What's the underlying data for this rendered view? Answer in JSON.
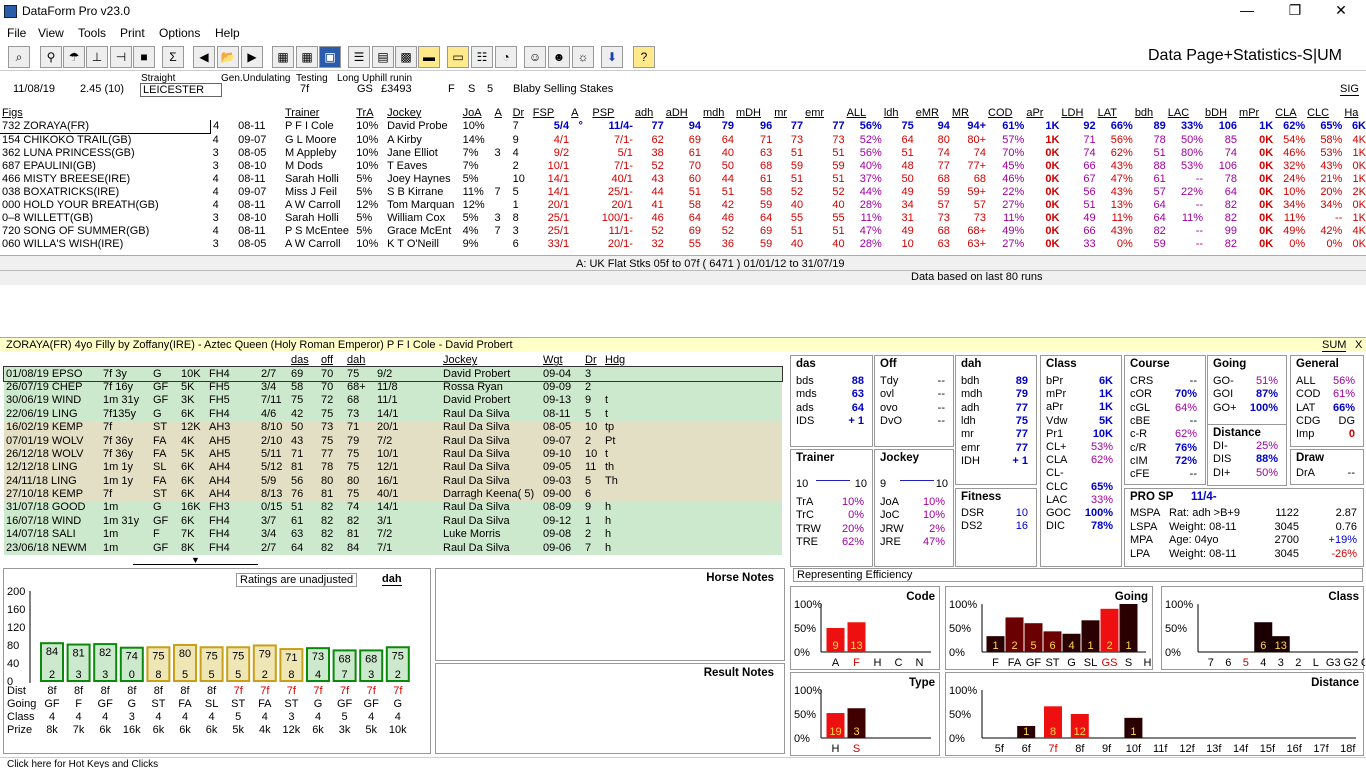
{
  "window": {
    "title": "DataForm Pro v23.0"
  },
  "menu": [
    "File",
    "View",
    "Tools",
    "Print",
    "Options",
    "Help"
  ],
  "page_title": "Data Page+Statistics-S|UM",
  "race": {
    "date": "11/08/19",
    "time": "2.45 (10)",
    "straight": "Straight",
    "course": "LEICESTER",
    "gen": "Gen.Undulating",
    "testing": "Testing",
    "dist": "7f",
    "uphill": "Long Uphill runin",
    "gs": "GS",
    "prize": "£3493",
    "f": "F",
    "s": "S",
    "n": "5",
    "name": "Blaby Selling Stakes",
    "sig": "SIG"
  },
  "runner_headers": [
    "Figs",
    "",
    "",
    "Trainer",
    "TrA",
    "Jockey",
    "JoA",
    "A",
    "Dr",
    "FSP",
    "A",
    "PSP",
    "adh",
    "aDH",
    "mdh",
    "mDH",
    "mr",
    "emr",
    "ALL",
    "ldh",
    "eMR",
    "MR",
    "COD",
    "aPr",
    "LDH",
    "LAT",
    "bdh",
    "LAC",
    "bDH",
    "mPr",
    "CLA",
    "CLC",
    "Ha"
  ],
  "runners": [
    [
      "732 ZORAYA(FR)",
      "4",
      "08-11",
      "P F I Cole",
      "10%",
      "David Probe",
      "10%",
      "",
      "7",
      "5/4",
      "°",
      "11/4-",
      "77",
      "94",
      "79",
      "96",
      "77",
      "77",
      "56%",
      "75",
      "94",
      "94+",
      "61%",
      "1K",
      "92",
      "66%",
      "89",
      "33%",
      "106",
      "1K",
      "62%",
      "65%",
      "6K"
    ],
    [
      "154 CHIKOKO TRAIL(GB)",
      "4",
      "09-07",
      "G L Moore",
      "10%",
      "A Kirby",
      "14%",
      "",
      "9",
      "4/1",
      "",
      "7/1-",
      "62",
      "69",
      "64",
      "71",
      "73",
      "73",
      "52%",
      "64",
      "80",
      "80+",
      "57%",
      "1K",
      "71",
      "56%",
      "78",
      "50%",
      "85",
      "0K",
      "54%",
      "58%",
      "4K"
    ],
    [
      "362 LUNA PRINCESS(GB)",
      "3",
      "08-05",
      "M Appleby",
      "10%",
      "Jane Elliot",
      "7%",
      "3",
      "4",
      "9/2",
      "",
      "5/1",
      "38",
      "61",
      "40",
      "63",
      "51",
      "51",
      "56%",
      "51",
      "74",
      "74",
      "70%",
      "0K",
      "74",
      "62%",
      "51",
      "80%",
      "74",
      "0K",
      "46%",
      "53%",
      "1K"
    ],
    [
      "687 EPAULINI(GB)",
      "3",
      "08-10",
      "M Dods",
      "10%",
      "T Eaves",
      "7%",
      "",
      "2",
      "10/1",
      "",
      "7/1-",
      "52",
      "70",
      "50",
      "68",
      "59",
      "59",
      "40%",
      "48",
      "77",
      "77+",
      "45%",
      "0K",
      "66",
      "43%",
      "88",
      "53%",
      "106",
      "0K",
      "32%",
      "43%",
      "0K"
    ],
    [
      "466 MISTY BREESE(IRE)",
      "4",
      "08-11",
      "Sarah Holli",
      "5%",
      "Joey Haynes",
      "5%",
      "",
      "10",
      "14/1",
      "",
      "40/1",
      "43",
      "60",
      "44",
      "61",
      "51",
      "51",
      "37%",
      "50",
      "68",
      "68",
      "46%",
      "0K",
      "67",
      "47%",
      "61",
      "--",
      "78",
      "0K",
      "24%",
      "21%",
      "1K"
    ],
    [
      "038 BOXATRICKS(IRE)",
      "4",
      "09-07",
      "Miss J Feil",
      "5%",
      "S B Kirrane",
      "11%",
      "7",
      "5",
      "14/1",
      "",
      "25/1-",
      "44",
      "51",
      "51",
      "58",
      "52",
      "52",
      "44%",
      "49",
      "59",
      "59+",
      "22%",
      "0K",
      "56",
      "43%",
      "57",
      "22%",
      "64",
      "0K",
      "10%",
      "20%",
      "2K"
    ],
    [
      "000 HOLD YOUR BREATH(GB)",
      "4",
      "08-11",
      "A W Carroll",
      "12%",
      "Tom Marquan",
      "12%",
      "",
      "1",
      "20/1",
      "",
      "20/1",
      "41",
      "58",
      "42",
      "59",
      "40",
      "40",
      "28%",
      "34",
      "57",
      "57",
      "27%",
      "0K",
      "51",
      "13%",
      "64",
      "--",
      "82",
      "0K",
      "34%",
      "34%",
      "0K"
    ],
    [
      "0–8 WILLETT(GB)",
      "3",
      "08-10",
      "Sarah Holli",
      "5%",
      "William Cox",
      "5%",
      "3",
      "8",
      "25/1",
      "",
      "100/1-",
      "46",
      "64",
      "46",
      "64",
      "55",
      "55",
      "11%",
      "31",
      "73",
      "73",
      "11%",
      "0K",
      "49",
      "11%",
      "64",
      "11%",
      "82",
      "0K",
      "11%",
      "--",
      "1K"
    ],
    [
      "720 SONG OF SUMMER(GB)",
      "4",
      "08-11",
      "P S McEntee",
      "5%",
      "Grace McEnt",
      "4%",
      "7",
      "3",
      "25/1",
      "",
      "11/1-",
      "52",
      "69",
      "52",
      "69",
      "51",
      "51",
      "47%",
      "49",
      "68",
      "68+",
      "49%",
      "0K",
      "66",
      "43%",
      "82",
      "--",
      "99",
      "0K",
      "49%",
      "42%",
      "4K"
    ],
    [
      "060 WILLA'S WISH(IRE)",
      "3",
      "08-05",
      "A W Carroll",
      "10%",
      "K T O'Neill",
      "9%",
      "",
      "6",
      "33/1",
      "",
      "20/1-",
      "32",
      "55",
      "36",
      "59",
      "40",
      "40",
      "28%",
      "10",
      "63",
      "63+",
      "27%",
      "0K",
      "33",
      "0%",
      "59",
      "--",
      "82",
      "0K",
      "0%",
      "0%",
      "0K"
    ]
  ],
  "filter": {
    "line1": "A: UK Flat Stks 05f to 07f ( 6471 )   01/01/12 to 31/07/19",
    "line2": "Data based on last 80 runs"
  },
  "selected": {
    "text": "ZORAYA(FR)   4yo Filly by Zoffany(IRE) - Aztec Queen (Holy Roman Emperor)   P F I Cole  -  David Probert",
    "sum": "SUM",
    "close": "X"
  },
  "form_headers": [
    "",
    "",
    "",
    "",
    "",
    "",
    "das",
    "off",
    "dah",
    "",
    "Jockey",
    "Wgt",
    "Dr",
    "Hdg"
  ],
  "form": [
    [
      "01/08/19 EPSO",
      "7f 3y",
      "G",
      "10K",
      "FH4",
      "2/7",
      "69",
      "70",
      "75",
      "9/2",
      "David Probert",
      "09-04",
      "3",
      ""
    ],
    [
      "26/07/19 CHEP",
      "7f 16y",
      "GF",
      "5K",
      "FH5",
      "3/4",
      "58",
      "70",
      "68+",
      "11/8",
      "Rossa Ryan",
      "09-09",
      "2",
      ""
    ],
    [
      "30/06/19 WIND",
      "1m 31y",
      "GF",
      "3K",
      "FH5",
      "7/11",
      "75",
      "72",
      "68",
      "11/1",
      "David Probert",
      "09-13",
      "9",
      "t"
    ],
    [
      "22/06/19 LING",
      "7f135y",
      "G",
      "6K",
      "FH4",
      "4/6",
      "42",
      "75",
      "73",
      "14/1",
      "Raul Da Silva",
      "08-11",
      "5",
      "t"
    ],
    [
      "16/02/19 KEMP",
      "7f",
      "ST",
      "12K",
      "AH3",
      "8/10",
      "50",
      "73",
      "71",
      "20/1",
      "Raul Da Silva",
      "08-05",
      "10",
      "tp"
    ],
    [
      "07/01/19 WOLV",
      "7f 36y",
      "FA",
      "4K",
      "AH5",
      "2/10",
      "43",
      "75",
      "79",
      "7/2",
      "Raul Da Silva",
      "09-07",
      "2",
      "Pt"
    ],
    [
      "26/12/18 WOLV",
      "7f 36y",
      "FA",
      "5K",
      "AH5",
      "5/11",
      "71",
      "77",
      "75",
      "10/1",
      "Raul Da Silva",
      "09-10",
      "10",
      "t"
    ],
    [
      "12/12/18 LING",
      "1m 1y",
      "SL",
      "6K",
      "AH4",
      "5/12",
      "81",
      "78",
      "75",
      "12/1",
      "Raul Da Silva",
      "09-05",
      "11",
      "th"
    ],
    [
      "24/11/18 LING",
      "1m 1y",
      "FA",
      "6K",
      "AH4",
      "5/9",
      "56",
      "80",
      "80",
      "16/1",
      "Raul Da Silva",
      "09-03",
      "5",
      "Th"
    ],
    [
      "27/10/18 KEMP",
      "7f",
      "ST",
      "6K",
      "AH4",
      "8/13",
      "76",
      "81",
      "75",
      "40/1",
      "Darragh Keena( 5)",
      "09-00",
      "6",
      ""
    ],
    [
      "31/07/18 GOOD",
      "1m",
      "G",
      "16K",
      "FH3",
      "0/15",
      "51",
      "82",
      "74",
      "14/1",
      "Raul Da Silva",
      "08-09",
      "9",
      "h"
    ],
    [
      "16/07/18 WIND",
      "1m 31y",
      "GF",
      "6K",
      "FH4",
      "3/7",
      "61",
      "82",
      "82",
      "3/1",
      "Raul Da Silva",
      "09-12",
      "1",
      "h"
    ],
    [
      "14/07/18 SALI",
      "1m",
      "F",
      "7K",
      "FH4",
      "3/4",
      "63",
      "82",
      "81",
      "7/2",
      "Luke Morris",
      "09-08",
      "2",
      "h"
    ],
    [
      "23/06/18 NEWM",
      "1m",
      "GF",
      "8K",
      "FH4",
      "2/7",
      "64",
      "82",
      "84",
      "7/1",
      "Raul Da Silva",
      "09-06",
      "7",
      "h"
    ]
  ],
  "ratings_chart": {
    "label": "Ratings are unadjusted",
    "mode": "dah",
    "y_ticks": [
      "200",
      "160",
      "120",
      "80",
      "40",
      "0"
    ],
    "bars": [
      [
        "84",
        "2"
      ],
      [
        "81",
        "3"
      ],
      [
        "82",
        "3"
      ],
      [
        "74",
        "0"
      ],
      [
        "75",
        "8"
      ],
      [
        "80",
        "5"
      ],
      [
        "75",
        "5"
      ],
      [
        "75",
        "5"
      ],
      [
        "79",
        "2"
      ],
      [
        "71",
        "8"
      ],
      [
        "73",
        "4"
      ],
      [
        "68",
        "7"
      ],
      [
        "68",
        "3"
      ],
      [
        "75",
        "2"
      ]
    ],
    "rows": {
      "Dist": [
        "8f",
        "8f",
        "8f",
        "8f",
        "8f",
        "8f",
        "8f",
        "7f",
        "7f",
        "7f",
        "7f",
        "7f",
        "7f",
        "7f"
      ],
      "Going": [
        "GF",
        "F",
        "GF",
        "G",
        "ST",
        "FA",
        "SL",
        "ST",
        "FA",
        "ST",
        "G",
        "GF",
        "GF",
        "G"
      ],
      "Class": [
        "4",
        "4",
        "4",
        "3",
        "4",
        "4",
        "4",
        "5",
        "4",
        "3",
        "4",
        "5",
        "4",
        "4"
      ],
      "Prize": [
        "8k",
        "7k",
        "6k",
        "16k",
        "6k",
        "6k",
        "6k",
        "5k",
        "4k",
        "12k",
        "6k",
        "3k",
        "5k",
        "10k"
      ]
    }
  },
  "notes": {
    "horse": "Horse Notes",
    "result": "Result Notes"
  },
  "stats": {
    "das": {
      "title": "das",
      "items": [
        [
          "bds",
          "88"
        ],
        [
          "mds",
          "63"
        ],
        [
          "ads",
          "64"
        ],
        [
          "IDS",
          "+ 1"
        ]
      ]
    },
    "off": {
      "title": "Off",
      "items": [
        [
          "Tdy",
          "--"
        ],
        [
          "ovl",
          "--"
        ],
        [
          "ovo",
          "--"
        ],
        [
          "DvO",
          "--"
        ]
      ]
    },
    "dah": {
      "title": "dah",
      "items": [
        [
          "bdh",
          "89"
        ],
        [
          "mdh",
          "79"
        ],
        [
          "adh",
          "77"
        ],
        [
          "ldh",
          "75"
        ],
        [
          "mr",
          "77"
        ],
        [
          "emr",
          "77"
        ],
        [
          "IDH",
          "+ 1"
        ]
      ]
    },
    "class": {
      "title": "Class",
      "items": [
        [
          "bPr",
          "6K"
        ],
        [
          "mPr",
          "1K"
        ],
        [
          "aPr",
          "1K"
        ],
        [
          "Vdw",
          "5K"
        ],
        [
          "Pr1",
          "10K"
        ],
        [
          "CL+",
          "53%"
        ],
        [
          "CLA",
          "62%"
        ],
        [
          "CL-",
          ""
        ],
        [
          "CLC",
          "65%"
        ],
        [
          "LAC",
          "33%"
        ],
        [
          "GOC",
          "100%"
        ],
        [
          "DIC",
          "78%"
        ]
      ]
    },
    "course": {
      "title": "Course",
      "items": [
        [
          "CRS",
          "--"
        ],
        [
          "cOR",
          "70%"
        ],
        [
          "cGL",
          "64%"
        ],
        [
          "cBE",
          "--"
        ],
        [
          "c-R",
          "62%"
        ],
        [
          "c/R",
          "76%"
        ],
        [
          "cIM",
          "72%"
        ],
        [
          "cFE",
          "--"
        ]
      ]
    },
    "going": {
      "title": "Going",
      "items": [
        [
          "GO-",
          "51%"
        ],
        [
          "GOI",
          "87%"
        ],
        [
          "GO+",
          "100%"
        ]
      ]
    },
    "distance": {
      "title": "Distance",
      "items": [
        [
          "DI-",
          "25%"
        ],
        [
          "DIS",
          "88%"
        ],
        [
          "DI+",
          "50%"
        ]
      ]
    },
    "general": {
      "title": "General",
      "items": [
        [
          "ALL",
          "56%"
        ],
        [
          "COD",
          "61%"
        ],
        [
          "LAT",
          "66%"
        ],
        [
          "CDG",
          "DG"
        ],
        [
          "Imp",
          "0"
        ]
      ]
    },
    "draw": {
      "title": "Draw",
      "items": [
        [
          "DrA",
          "--"
        ]
      ]
    },
    "trainer": {
      "title": "Trainer",
      "scale": [
        "10",
        "10"
      ],
      "items": [
        [
          "TrA",
          "10%"
        ],
        [
          "TrC",
          "0%"
        ],
        [
          "TRW",
          "20%"
        ],
        [
          "TRE",
          "62%"
        ]
      ]
    },
    "jockey": {
      "title": "Jockey",
      "scale": [
        "9",
        "10"
      ],
      "items": [
        [
          "JoA",
          "10%"
        ],
        [
          "JoC",
          "10%"
        ],
        [
          "JRW",
          "2%"
        ],
        [
          "JRE",
          "47%"
        ]
      ]
    },
    "fitness": {
      "title": "Fitness",
      "items": [
        [
          "DSR",
          "10"
        ],
        [
          "DS2",
          "16"
        ]
      ]
    },
    "prosp": {
      "title": "PRO SP",
      "sp": "11/4-",
      "rows": [
        [
          "MSPA",
          "Rat: adh >B+9",
          "1122",
          "2.87"
        ],
        [
          "LSPA",
          "Weight: 08-11",
          "3045",
          "0.76"
        ],
        [
          "MPA",
          "Age: 04yo",
          "2700",
          "+19%"
        ],
        [
          "LPA",
          "Weight: 08-11",
          "3045",
          "-26%"
        ]
      ]
    }
  },
  "eff": {
    "label": "Representing Efficiency",
    "code": {
      "title": "Code",
      "yt": [
        "100%",
        "50%",
        "0%"
      ],
      "cats": [
        "A",
        "F",
        "H",
        "C",
        "N"
      ],
      "bars": [
        [
          "9",
          0.5
        ],
        [
          "13",
          0.62
        ],
        [
          "",
          0
        ],
        [
          "",
          0
        ],
        [
          "",
          0
        ]
      ]
    },
    "going": {
      "title": "Going",
      "yt": [
        "100%",
        "50%",
        "0%"
      ],
      "cats": [
        "F",
        "FA",
        "GF",
        "ST",
        "G",
        "SL",
        "GS",
        "S",
        "H"
      ],
      "bars": [
        [
          "1",
          0.33
        ],
        [
          "2",
          0.72
        ],
        [
          "5",
          0.6
        ],
        [
          "6",
          0.43
        ],
        [
          "4",
          0.38
        ],
        [
          "1",
          0.66
        ],
        [
          "2",
          0.9
        ],
        [
          "1",
          1.0
        ],
        [
          "",
          0
        ]
      ]
    },
    "class": {
      "title": "Class",
      "yt": [
        "100%",
        "50%",
        "0%"
      ],
      "cats": [
        "7",
        "6",
        "5",
        "4",
        "3",
        "2",
        "L",
        "G3",
        "G2",
        "G1"
      ],
      "bars": [
        [
          "",
          0
        ],
        [
          "",
          0
        ],
        [
          "",
          0
        ],
        [
          "6",
          0.62
        ],
        [
          "13",
          0.33
        ],
        [
          "",
          0
        ],
        [
          "",
          0
        ],
        [
          "",
          0
        ],
        [
          "",
          0
        ],
        [
          "",
          0
        ]
      ]
    },
    "type": {
      "title": "Type",
      "yt": [
        "100%",
        "50%",
        "0%"
      ],
      "cats": [
        "H",
        "S"
      ],
      "bars": [
        [
          "19",
          0.52
        ],
        [
          "3",
          0.62
        ]
      ]
    },
    "distance": {
      "title": "Distance",
      "yt": [
        "100%",
        "50%",
        "0%"
      ],
      "cats": [
        "5f",
        "6f",
        "7f",
        "8f",
        "9f",
        "10f",
        "11f",
        "12f",
        "13f",
        "14f",
        "15f",
        "16f",
        "17f",
        "18f",
        "19f"
      ],
      "bars": [
        [
          "",
          0
        ],
        [
          "1",
          0.25
        ],
        [
          "8",
          0.66
        ],
        [
          "12",
          0.5
        ],
        [
          "",
          0
        ],
        [
          "1",
          0.42
        ],
        [
          "",
          0
        ],
        [
          "",
          0
        ],
        [
          "",
          0
        ],
        [
          "",
          0
        ],
        [
          "",
          0
        ],
        [
          "",
          0
        ],
        [
          "",
          0
        ],
        [
          "",
          0
        ],
        [
          "",
          0
        ]
      ]
    }
  },
  "status": "Click here for Hot Keys and Clicks"
}
